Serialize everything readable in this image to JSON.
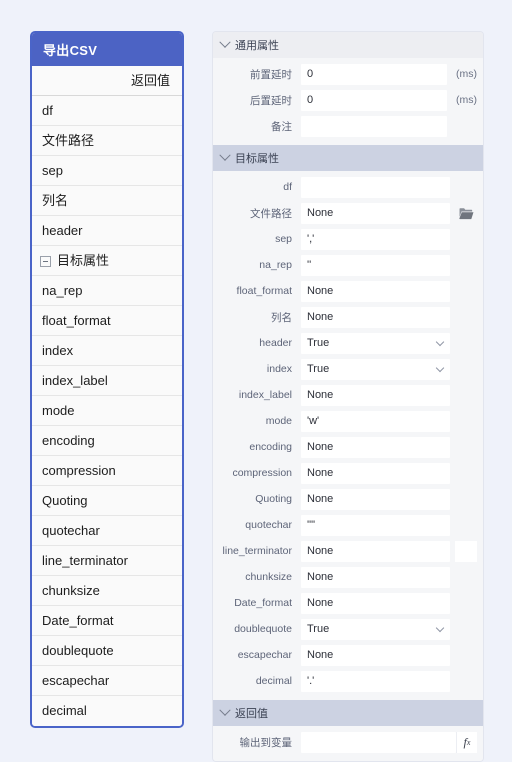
{
  "colors": {
    "page_background": "#eff2fa",
    "accent_header": "#4c63c4",
    "panel_border": "#4a64c8",
    "section_target_bg": "#ccd2e2",
    "section_general_bg": "#edeef2"
  },
  "left_panel": {
    "title": "导出CSV",
    "return_label": "返回值",
    "items": [
      {
        "label": "df",
        "type": "field"
      },
      {
        "label": "文件路径",
        "type": "field"
      },
      {
        "label": "sep",
        "type": "field"
      },
      {
        "label": "列名",
        "type": "field"
      },
      {
        "label": "header",
        "type": "field"
      },
      {
        "label": "目标属性",
        "type": "group",
        "expanded": true
      },
      {
        "label": "na_rep",
        "type": "field"
      },
      {
        "label": "float_format",
        "type": "field"
      },
      {
        "label": "index",
        "type": "field"
      },
      {
        "label": "index_label",
        "type": "field"
      },
      {
        "label": "mode",
        "type": "field"
      },
      {
        "label": "encoding",
        "type": "field"
      },
      {
        "label": "compression",
        "type": "field"
      },
      {
        "label": "Quoting",
        "type": "field"
      },
      {
        "label": "quotechar",
        "type": "field"
      },
      {
        "label": "line_terminator",
        "type": "field"
      },
      {
        "label": "chunksize",
        "type": "field"
      },
      {
        "label": "Date_format",
        "type": "field"
      },
      {
        "label": "doublequote",
        "type": "field"
      },
      {
        "label": "escapechar",
        "type": "field"
      },
      {
        "label": "decimal",
        "type": "field"
      }
    ]
  },
  "right_panel": {
    "sections": {
      "general": {
        "title": "通用属性",
        "expanded": true,
        "rows": [
          {
            "label": "前置延时",
            "value": "0",
            "control": "text",
            "suffix": "(ms)"
          },
          {
            "label": "后置延时",
            "value": "0",
            "control": "text",
            "suffix": "(ms)"
          },
          {
            "label": "备注",
            "value": "",
            "control": "text",
            "suffix": ""
          }
        ]
      },
      "target": {
        "title": "目标属性",
        "expanded": true,
        "rows": [
          {
            "label": "df",
            "value": "",
            "control": "text"
          },
          {
            "label": "文件路径",
            "value": "None",
            "control": "text",
            "button": "folder-icon"
          },
          {
            "label": "sep",
            "value": "','",
            "control": "text"
          },
          {
            "label": "na_rep",
            "value": "''",
            "control": "text"
          },
          {
            "label": "float_format",
            "value": "None",
            "control": "text"
          },
          {
            "label": "列名",
            "value": "None",
            "control": "text"
          },
          {
            "label": "header",
            "value": "True",
            "control": "select"
          },
          {
            "label": "index",
            "value": "True",
            "control": "select"
          },
          {
            "label": "index_label",
            "value": "None",
            "control": "text"
          },
          {
            "label": "mode",
            "value": "'w'",
            "control": "text"
          },
          {
            "label": "encoding",
            "value": "None",
            "control": "text"
          },
          {
            "label": "compression",
            "value": "None",
            "control": "text"
          },
          {
            "label": "Quoting",
            "value": "None",
            "control": "text"
          },
          {
            "label": "quotechar",
            "value": "'\"'",
            "control": "text"
          },
          {
            "label": "line_terminator",
            "value": "None",
            "control": "text",
            "button": "blank-button"
          },
          {
            "label": "chunksize",
            "value": "None",
            "control": "text"
          },
          {
            "label": "Date_format",
            "value": "None",
            "control": "text"
          },
          {
            "label": "doublequote",
            "value": "True",
            "control": "select"
          },
          {
            "label": "escapechar",
            "value": "None",
            "control": "text"
          },
          {
            "label": "decimal",
            "value": "'.'",
            "control": "text"
          }
        ]
      },
      "return": {
        "title": "返回值",
        "expanded": true,
        "rows": [
          {
            "label": "输出到变量",
            "value": "",
            "control": "text",
            "button": "fx-icon",
            "fx_label": "f",
            "fx_sub": "x"
          }
        ]
      }
    }
  }
}
